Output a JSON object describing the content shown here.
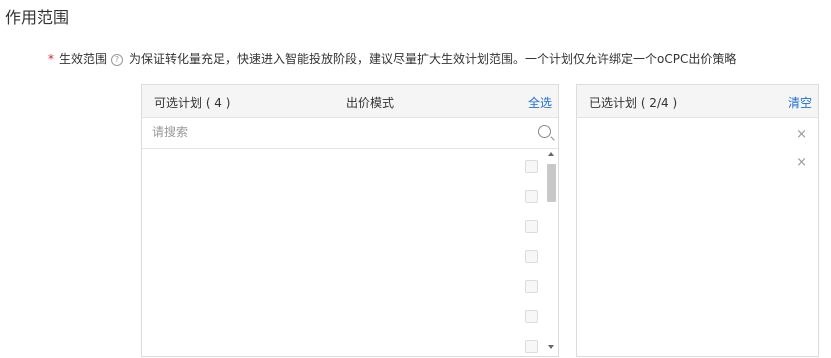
{
  "section": {
    "title": "作用范围"
  },
  "field": {
    "required_mark": "*",
    "label": "生效范围",
    "help_icon": "question-circle-icon",
    "help_glyph": "?",
    "description": "为保证转化量充足，快速进入智能投放阶段，建议尽量扩大生效计划范围。一个计划仅允许绑定一个oCPC出价策略"
  },
  "available": {
    "title": "可选计划 ( 4 )",
    "mode_header": "出价模式",
    "select_all": "全选",
    "search_placeholder": "请搜索",
    "search_icon": "search-icon",
    "checkbox_count": 7
  },
  "selected": {
    "title": "已选计划 ( 2/4 )",
    "clear": "清空",
    "remove_icon": "close-icon",
    "remove_glyph": "×"
  },
  "colors": {
    "link": "#1e6fd6",
    "required": "#e02020",
    "header_bg": "#f5f5f5",
    "border": "#dcdcdc"
  }
}
